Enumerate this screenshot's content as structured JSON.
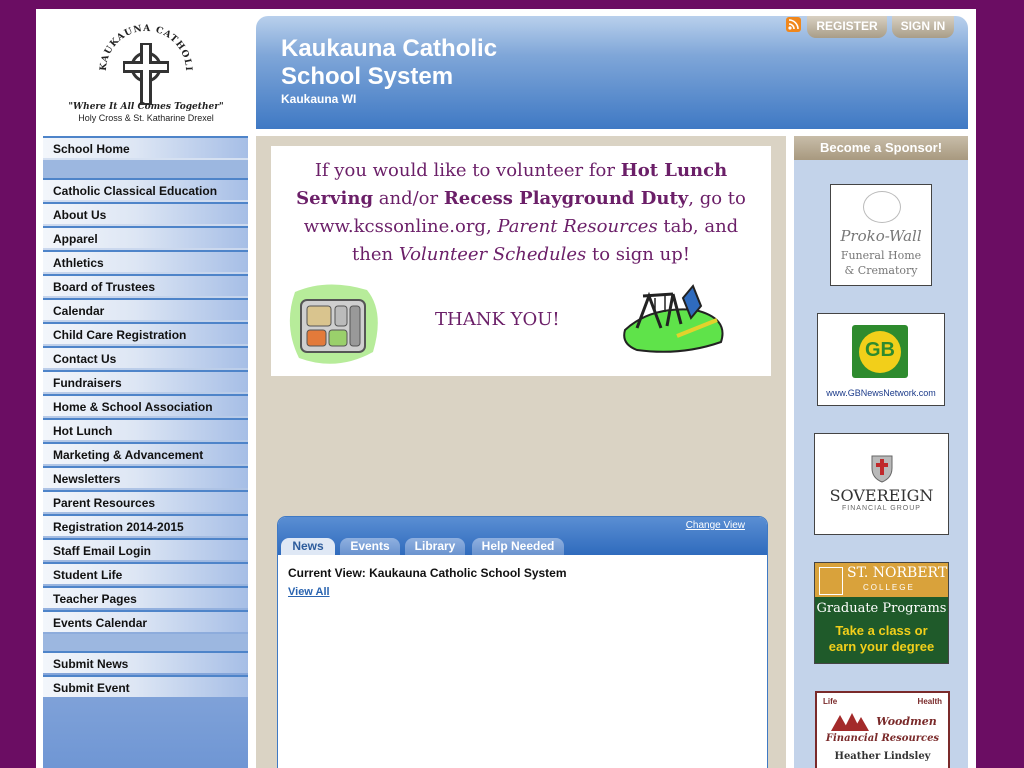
{
  "colors": {
    "page_bg": "#6b0d63",
    "header_blue": "#3f79c4",
    "banner_purple": "#6b1f68",
    "sponsor_bar": "#a8997f"
  },
  "logo": {
    "seal_text": "KAUKAUNA CATHOLIC SCHOOL SYSTEM",
    "motto": "\"Where It All Comes Together\"",
    "schools": "Holy Cross & St. Katharine Drexel"
  },
  "header": {
    "title": "Kaukauna Catholic School System",
    "location": "Kaukauna WI",
    "rss_icon": "rss-icon",
    "register_label": "REGISTER",
    "signin_label": "SIGN IN"
  },
  "sidebar": {
    "home": "School Home",
    "items": [
      "Catholic Classical Education",
      "About Us",
      "Apparel",
      "Athletics",
      "Board of Trustees",
      "Calendar",
      "Child Care Registration",
      "Contact Us",
      "Fundraisers",
      "Home & School Association",
      "Hot Lunch",
      "Marketing & Advancement",
      "Newsletters",
      "Parent Resources",
      "Registration 2014-2015",
      "Staff Email Login",
      "Student Life",
      "Teacher Pages",
      "Events Calendar"
    ],
    "submit_items": [
      "Submit News",
      "Submit Event"
    ]
  },
  "banner": {
    "line1_pre": "If you would like to volunteer for ",
    "line1_bold": "Hot Lunch",
    "line2_bold1": "Serving",
    "line2_mid": " and/or ",
    "line2_bold2": "Recess Playground Duty",
    "line2_post": ",  go to",
    "line3_pre": "www.kcssonline.org, ",
    "line3_it": "Parent Resources",
    "line3_post": " tab, and",
    "line4_pre": "then ",
    "line4_it": "Volunteer Schedules",
    "line4_post": " to sign up!",
    "thank_you": "THANK YOU!"
  },
  "news": {
    "change_view": "Change View",
    "tabs": [
      "News",
      "Events",
      "Library",
      "Help Needed"
    ],
    "active_tab": "News",
    "current_view": "Current View: Kaukauna Catholic School System",
    "view_all": "View All"
  },
  "sponsors": {
    "heading": "Become a Sponsor!",
    "prokowall": {
      "name": "Proko-Wall",
      "line2": "Funeral Home",
      "line3": "& Crematory"
    },
    "gb": {
      "logo": "GB",
      "url": "www.GBNewsNetwork.com"
    },
    "sovereign": {
      "name": "SOVEREIGN",
      "sub": "FINANCIAL GROUP"
    },
    "stnorbert": {
      "name": "ST. NORBERT",
      "college": "COLLEGE",
      "programs": "Graduate Programs",
      "cta1": "Take a class or",
      "cta2": "earn your degree"
    },
    "woodmen": {
      "life": "Life",
      "health": "Health",
      "name1": "Woodmen",
      "name2": "Financial Resources",
      "person": "Heather Lindsley"
    }
  }
}
